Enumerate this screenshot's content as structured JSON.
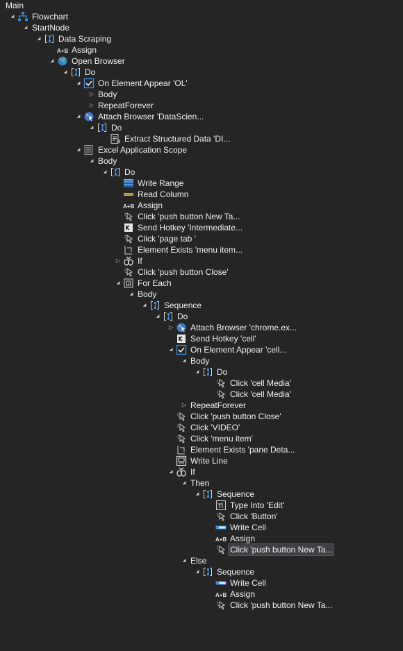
{
  "tree": [
    {
      "label": "Main",
      "depth": 0,
      "icon": "",
      "toggle": ""
    },
    {
      "label": "Flowchart",
      "depth": 1,
      "icon": "flowchart-icon",
      "toggle": "open"
    },
    {
      "label": "StartNode",
      "depth": 2,
      "icon": "",
      "toggle": "open"
    },
    {
      "label": "Data Scraping",
      "depth": 3,
      "icon": "sequence-icon",
      "toggle": "open"
    },
    {
      "label": "Assign",
      "depth": 4,
      "icon": "assign-icon",
      "toggle": ""
    },
    {
      "label": "Open Browser",
      "depth": 4,
      "icon": "globe-icon",
      "toggle": "open"
    },
    {
      "label": "Do",
      "depth": 5,
      "icon": "sequence-icon",
      "toggle": "open"
    },
    {
      "label": "On Element Appear 'OL'",
      "depth": 6,
      "icon": "checkbox-icon",
      "toggle": "open"
    },
    {
      "label": "Body",
      "depth": 7,
      "icon": "",
      "toggle": "closed"
    },
    {
      "label": "RepeatForever",
      "depth": 7,
      "icon": "",
      "toggle": "closed"
    },
    {
      "label": "Attach Browser 'DataScien...",
      "depth": 6,
      "icon": "globe-cursor-icon",
      "toggle": "open"
    },
    {
      "label": "Do",
      "depth": 7,
      "icon": "sequence-icon",
      "toggle": "open"
    },
    {
      "label": "Extract Structured Data 'DI...",
      "depth": 8,
      "icon": "extract-data-icon",
      "toggle": ""
    },
    {
      "label": "Excel Application Scope",
      "depth": 6,
      "icon": "excel-scope-icon",
      "toggle": "open"
    },
    {
      "label": "Body",
      "depth": 7,
      "icon": "",
      "toggle": "open"
    },
    {
      "label": "Do",
      "depth": 8,
      "icon": "sequence-icon",
      "toggle": "open"
    },
    {
      "label": "Write Range",
      "depth": 9,
      "icon": "write-range-icon",
      "toggle": ""
    },
    {
      "label": "Read Column",
      "depth": 9,
      "icon": "read-column-icon",
      "toggle": ""
    },
    {
      "label": "Assign",
      "depth": 9,
      "icon": "assign-icon",
      "toggle": ""
    },
    {
      "label": "Click 'push button  New Ta...",
      "depth": 9,
      "icon": "click-icon",
      "toggle": ""
    },
    {
      "label": "Send Hotkey 'Intermediate...",
      "depth": 9,
      "icon": "hotkey-icon",
      "toggle": ""
    },
    {
      "label": "Click 'page tab '",
      "depth": 9,
      "icon": "click-icon",
      "toggle": ""
    },
    {
      "label": "Element Exists 'menu item...",
      "depth": 9,
      "icon": "element-exists-icon",
      "toggle": ""
    },
    {
      "label": "If",
      "depth": 9,
      "icon": "if-icon",
      "toggle": "closed"
    },
    {
      "label": "Click 'push button  Close'",
      "depth": 9,
      "icon": "click-icon",
      "toggle": ""
    },
    {
      "label": "For Each",
      "depth": 9,
      "icon": "for-each-icon",
      "toggle": "open"
    },
    {
      "label": "Body",
      "depth": 10,
      "icon": "",
      "toggle": "open"
    },
    {
      "label": "Sequence",
      "depth": 11,
      "icon": "sequence-icon",
      "toggle": "open"
    },
    {
      "label": "Do",
      "depth": 12,
      "icon": "sequence-icon",
      "toggle": "open"
    },
    {
      "label": "Attach Browser 'chrome.ex...",
      "depth": 13,
      "icon": "globe-cursor-icon",
      "toggle": "closed"
    },
    {
      "label": "Send Hotkey 'cell'",
      "depth": 13,
      "icon": "hotkey-icon",
      "toggle": ""
    },
    {
      "label": "On Element Appear 'cell...",
      "depth": 13,
      "icon": "checkbox-icon",
      "toggle": "open"
    },
    {
      "label": "Body",
      "depth": 14,
      "icon": "",
      "toggle": "open"
    },
    {
      "label": "Do",
      "depth": 15,
      "icon": "sequence-icon",
      "toggle": "open"
    },
    {
      "label": "Click 'cell  Media'",
      "depth": 16,
      "icon": "click-icon",
      "toggle": ""
    },
    {
      "label": "Click 'cell  Media'",
      "depth": 16,
      "icon": "click-icon",
      "toggle": ""
    },
    {
      "label": "RepeatForever",
      "depth": 14,
      "icon": "",
      "toggle": "closed"
    },
    {
      "label": "Click 'push button  Close'",
      "depth": 13,
      "icon": "click-icon",
      "toggle": ""
    },
    {
      "label": "Click 'VIDEO'",
      "depth": 13,
      "icon": "click-icon",
      "toggle": ""
    },
    {
      "label": "Click 'menu item'",
      "depth": 13,
      "icon": "click-icon",
      "toggle": ""
    },
    {
      "label": "Element Exists 'pane  Deta...",
      "depth": 13,
      "icon": "element-exists-icon",
      "toggle": ""
    },
    {
      "label": "Write Line",
      "depth": 13,
      "icon": "write-line-icon",
      "toggle": ""
    },
    {
      "label": "If",
      "depth": 13,
      "icon": "if-icon",
      "toggle": "open"
    },
    {
      "label": "Then",
      "depth": 14,
      "icon": "",
      "toggle": "open"
    },
    {
      "label": "Sequence",
      "depth": 15,
      "icon": "sequence-icon",
      "toggle": "open"
    },
    {
      "label": "Type Into 'Edit'",
      "depth": 16,
      "icon": "type-into-icon",
      "toggle": ""
    },
    {
      "label": "Click 'Button'",
      "depth": 16,
      "icon": "click-icon",
      "toggle": ""
    },
    {
      "label": "Write Cell",
      "depth": 16,
      "icon": "write-cell-icon",
      "toggle": ""
    },
    {
      "label": "Assign",
      "depth": 16,
      "icon": "assign-icon",
      "toggle": ""
    },
    {
      "label": "Click 'push button  New Ta...",
      "depth": 16,
      "icon": "click-icon",
      "toggle": "",
      "selected": true
    },
    {
      "label": "Else",
      "depth": 14,
      "icon": "",
      "toggle": "open"
    },
    {
      "label": "Sequence",
      "depth": 15,
      "icon": "sequence-icon",
      "toggle": "open"
    },
    {
      "label": "Write Cell",
      "depth": 16,
      "icon": "write-cell-icon",
      "toggle": ""
    },
    {
      "label": "Assign",
      "depth": 16,
      "icon": "assign-icon",
      "toggle": ""
    },
    {
      "label": "Click 'push button  New Ta...",
      "depth": 16,
      "icon": "click-icon",
      "toggle": ""
    }
  ]
}
